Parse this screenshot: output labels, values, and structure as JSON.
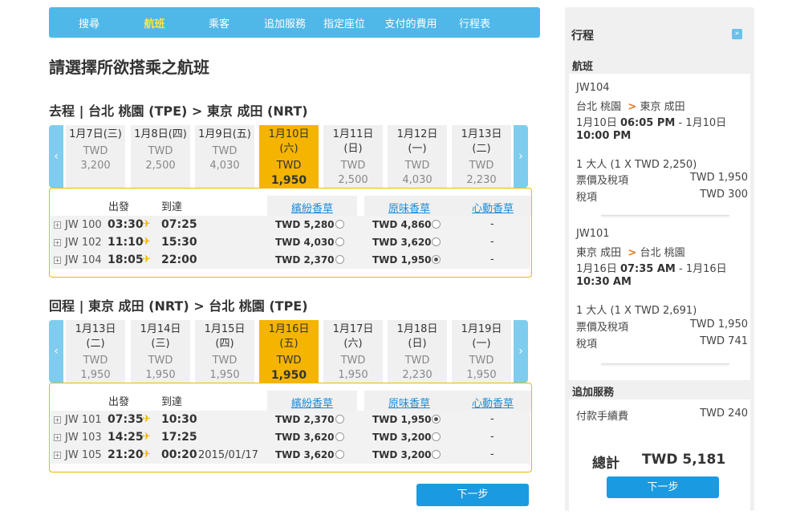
{
  "nav": [
    "搜尋",
    "航班",
    "乘客",
    "追加服務",
    "指定座位",
    "支付的費用",
    "行程表"
  ],
  "page_title": "請選擇所欲搭乘之航班",
  "outbound": {
    "title": "去程 | 台北 桃園 (TPE) > 東京 成田 (NRT)",
    "dates": [
      {
        "date": "1月7日(三)",
        "currency": "TWD",
        "price": "3,200"
      },
      {
        "date": "1月8日(四)",
        "currency": "TWD",
        "price": "2,500"
      },
      {
        "date": "1月9日(五)",
        "currency": "TWD",
        "price": "4,030"
      },
      {
        "date": "1月10日(六)",
        "currency": "TWD",
        "price": "1,950"
      },
      {
        "date": "1月11日(日)",
        "currency": "TWD",
        "price": "2,500"
      },
      {
        "date": "1月12日(一)",
        "currency": "TWD",
        "price": "4,030"
      },
      {
        "date": "1月13日(二)",
        "currency": "TWD",
        "price": "2,230"
      }
    ],
    "header": {
      "dep": "出發",
      "arr": "到達",
      "fare1": "繽紛香草",
      "fare2": "原味香草",
      "fare3": "心動香草"
    },
    "flights": [
      {
        "flight": "JW 100",
        "dep": "03:30",
        "arr": "07:25",
        "fare1": "TWD 5,280",
        "fare2": "TWD 4,860",
        "fare3": "-"
      },
      {
        "flight": "JW 102",
        "dep": "11:10",
        "arr": "15:30",
        "fare1": "TWD 4,030",
        "fare2": "TWD 3,620",
        "fare3": "-"
      },
      {
        "flight": "JW 104",
        "dep": "18:05",
        "arr": "22:00",
        "fare1": "TWD 2,370",
        "fare2": "TWD 1,950",
        "fare3": "-"
      }
    ]
  },
  "inbound": {
    "title": "回程 | 東京 成田 (NRT) > 台北 桃園 (TPE)",
    "dates": [
      {
        "date": "1月13日(二)",
        "currency": "TWD",
        "price": "1,950"
      },
      {
        "date": "1月14日(三)",
        "currency": "TWD",
        "price": "1,950"
      },
      {
        "date": "1月15日(四)",
        "currency": "TWD",
        "price": "1,950"
      },
      {
        "date": "1月16日(五)",
        "currency": "TWD",
        "price": "1,950"
      },
      {
        "date": "1月17日(六)",
        "currency": "TWD",
        "price": "1,950"
      },
      {
        "date": "1月18日(日)",
        "currency": "TWD",
        "price": "2,230"
      },
      {
        "date": "1月19日(一)",
        "currency": "TWD",
        "price": "1,950"
      }
    ],
    "header": {
      "dep": "出發",
      "arr": "到達",
      "fare1": "繽紛香草",
      "fare2": "原味香草",
      "fare3": "心動香草"
    },
    "flights": [
      {
        "flight": "JW 101",
        "dep": "07:35",
        "arr": "10:30",
        "arr_extra": "",
        "fare1": "TWD 2,370",
        "fare2": "TWD 1,950",
        "fare3": "-"
      },
      {
        "flight": "JW 103",
        "dep": "14:25",
        "arr": "17:25",
        "arr_extra": "",
        "fare1": "TWD 3,620",
        "fare2": "TWD 3,200",
        "fare3": "-"
      },
      {
        "flight": "JW 105",
        "dep": "21:20",
        "arr": "00:20",
        "arr_extra": "2015/01/17",
        "fare1": "TWD 3,620",
        "fare2": "TWD 3,200",
        "fare3": "-"
      }
    ]
  },
  "next_label": "下一步",
  "sidebar": {
    "title": "行程",
    "flight_header": "航班",
    "leg1": {
      "flight": "JW104",
      "from": "台北 桃園",
      "arrow": ">",
      "to": "東京 成田",
      "dep_date": "1月10日",
      "dep_time": "06:05 PM",
      "sep": "-",
      "arr_date": "1月10日",
      "arr_time": "10:00 PM",
      "pax": "1 大人 (1 X TWD 2,250)",
      "fare_label": "票價及稅項",
      "fare_value": "TWD 1,950",
      "tax_label": "稅項",
      "tax_value": "TWD 300"
    },
    "leg2": {
      "flight": "JW101",
      "from": "東京 成田",
      "arrow": ">",
      "to": "台北 桃園",
      "dep_date": "1月16日",
      "dep_time": "07:35 AM",
      "sep": "-",
      "arr_date": "1月16日",
      "arr_time": "10:30 AM",
      "pax": "1 大人 (1 X TWD 2,691)",
      "fare_label": "票價及稅項",
      "fare_value": "TWD 1,950",
      "tax_label": "稅項",
      "tax_value": "TWD 741"
    },
    "extras_header": "追加服務",
    "fee_label": "付款手續費",
    "fee_value": "TWD 240",
    "total_label": "總計",
    "total_value": "TWD 5,181",
    "next_label": "下一步"
  }
}
